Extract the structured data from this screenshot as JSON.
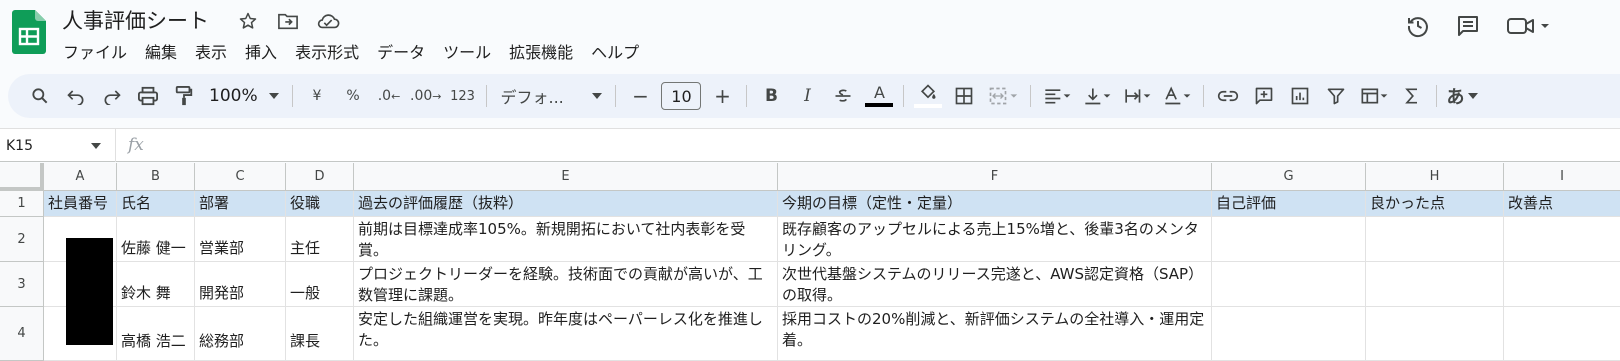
{
  "app": {
    "doc_title": "人事評価シート",
    "menu": [
      "ファイル",
      "編集",
      "表示",
      "挿入",
      "表示形式",
      "データ",
      "ツール",
      "拡張機能",
      "ヘルプ"
    ]
  },
  "toolbar": {
    "zoom": "100%",
    "currency": "¥",
    "percent": "%",
    "dec_decrease": ".0",
    "dec_increase": ".00",
    "number_format": "123",
    "font": "デフォ...",
    "font_size": "10",
    "bold": "B",
    "italic": "I",
    "text_color": "A",
    "input_tools": "あ"
  },
  "formula_bar": {
    "name_box": "K15",
    "fx": "fx"
  },
  "sheet": {
    "columns": [
      "A",
      "B",
      "C",
      "D",
      "E",
      "F",
      "G",
      "H",
      "I"
    ],
    "rows": [
      "1",
      "2",
      "3",
      "4"
    ],
    "header": [
      "社員番号",
      "氏名",
      "部署",
      "役職",
      "過去の評価履歴（抜粋）",
      "今期の目標（定性・定量）",
      "自己評価",
      "良かった点",
      "改善点"
    ],
    "data": [
      [
        "",
        "佐藤 健一",
        "営業部",
        "主任",
        "前期は目標達成率105%。新規開拓において社内表彰を受賞。",
        "既存顧客のアップセルによる売上15%増と、後輩3名のメンタリング。",
        "",
        "",
        ""
      ],
      [
        "",
        "鈴木 舞",
        "開発部",
        "一般",
        "プロジェクトリーダーを経験。技術面での貢献が高いが、工数管理に課題。",
        "次世代基盤システムのリリース完遂と、AWS認定資格（SAP）の取得。",
        "",
        "",
        ""
      ],
      [
        "",
        "高橋 浩二",
        "総務部",
        "課長",
        "安定した組織運営を実現。昨年度はペーパーレス化を推進した。",
        "採用コストの20%削減と、新評価システムの全社導入・運用定着。",
        "",
        "",
        ""
      ]
    ]
  },
  "colors": {
    "header_fill": "#cfe2f3",
    "sheets_green": "#0f9d58",
    "toolbar_bg": "#edf2fa"
  }
}
